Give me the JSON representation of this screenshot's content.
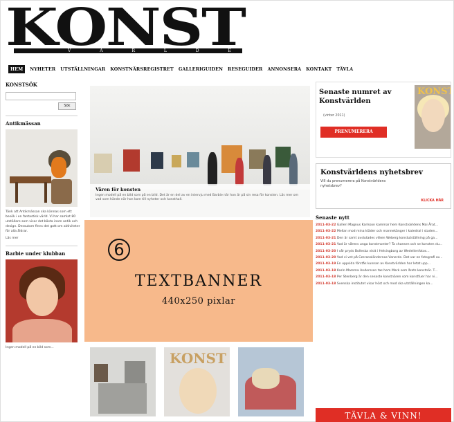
{
  "header": {
    "logo_text": "KONST",
    "logo_sub": "V Ä R L D E N"
  },
  "nav": {
    "items": [
      {
        "label": "HEM",
        "active": true
      },
      {
        "label": "NYHETER",
        "active": false
      },
      {
        "label": "UTSTÄLLNINGAR",
        "active": false
      },
      {
        "label": "KONSTNÄRSREGISTRET",
        "active": false
      },
      {
        "label": "GALLERIGUIDEN",
        "active": false
      },
      {
        "label": "RESEGUIDER",
        "active": false
      },
      {
        "label": "ANNONSERA",
        "active": false
      },
      {
        "label": "KONTAKT",
        "active": false
      },
      {
        "label": "TÄVLA",
        "active": false
      }
    ]
  },
  "left": {
    "search_head": "KONSTSÖK",
    "search_placeholder": "",
    "search_button": "Sök",
    "section1_head": "Antikmässan",
    "section1_text": "Tänk att Antikmässan ska kännas som ett besök i en fantastisk värld. Vi har samlat 80 utställare som visar det bästa inom antik och design. Dessutom finns det gott om aktiviteter för alla åldrar.",
    "section1_link": "Läs mer",
    "section2_head": "Barbie under klubban",
    "section2_text": "Ingen modell på en bild som..."
  },
  "hero": {
    "title": "Våren för konsten",
    "text": "Ingen modell på en bild som på en bild. Det är en del av en intervju med Barbie när hon är på sin resa för konsten. Läs mer om vad som hände när hon kom till nyheter och konsthall."
  },
  "banner": {
    "number": "6",
    "title": "TEXTBANNER",
    "size": "440x250 pixlar"
  },
  "thumbs": {
    "label": "",
    "mag_head": "KONST"
  },
  "right": {
    "issue_title": "Senaste numret av Konstvärlden",
    "issue_sub": "(vinter 2011)",
    "subscribe": "PRENUMERERA",
    "cover_head": "KONST",
    "news_title": "Konstvärldens nyhetsbrev",
    "news_sub": "Vill du prenumerera på Konstvärldens nyhetsbrev?",
    "news_link": "KLICKA HÄR",
    "latest_head": "Senaste nytt",
    "latest_items": [
      {
        "date": "2011-03-22",
        "text": "Galleri Magnus Karlsson kammar hem Konstvärldens Mai Årat..."
      },
      {
        "date": "2011-03-22",
        "text": "Mellan mod mina kläder och mannekänger i katedral i staden..."
      },
      {
        "date": "2011-03-21",
        "text": "Den är samt avslutades vilken Weberg konstutställning på ga..."
      },
      {
        "date": "2011-03-21",
        "text": "Vad är vårens unga konstmonter? Ta chansen och se konsten du..."
      },
      {
        "date": "2011-03-20",
        "text": "I vår pryds Bolleska vistt i Helsingborg av Wedelienfotos..."
      },
      {
        "date": "2011-03-20",
        "text": "Vad vi vet på Czeranoländernas Vanerde. Det var en fotografi av..."
      },
      {
        "date": "2011-03-19",
        "text": "En uppsida förstås kunnan av Konstvärlden har letat upp..."
      },
      {
        "date": "2011-03-18",
        "text": "Karin Mamma Andersson tas hem Mark som årets konstnär. T..."
      },
      {
        "date": "2011-03-18",
        "text": "Per Stenberg är den senaste konstnären som konstfuer har ni..."
      },
      {
        "date": "2011-03-18",
        "text": "Svenska institutet visar höst och mod ska utställningen ka..."
      }
    ],
    "win_button": "TÄVLA & VINN!"
  }
}
